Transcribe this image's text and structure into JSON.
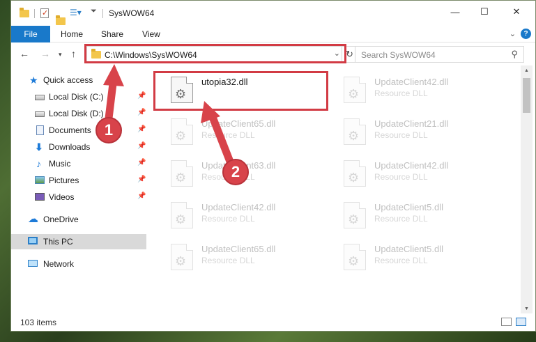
{
  "window": {
    "title": "SysWOW64"
  },
  "ribbon": {
    "tabs": [
      "File",
      "Home",
      "Share",
      "View"
    ],
    "expand_glyph": "⌄",
    "help_glyph": "?"
  },
  "address": {
    "path": "C:\\Windows\\SysWOW64",
    "search_placeholder": "Search SysWOW64"
  },
  "sidebar": {
    "items": [
      {
        "label": "Quick access",
        "icon": "star-icon",
        "pinned": false
      },
      {
        "label": "Local Disk (C:)",
        "icon": "drive-icon",
        "pinned": true
      },
      {
        "label": "Local Disk (D:)",
        "icon": "drive-icon",
        "pinned": true
      },
      {
        "label": "Documents",
        "icon": "document-icon",
        "pinned": true
      },
      {
        "label": "Downloads",
        "icon": "download-icon",
        "pinned": true
      },
      {
        "label": "Music",
        "icon": "music-icon",
        "pinned": true
      },
      {
        "label": "Pictures",
        "icon": "pictures-icon",
        "pinned": true
      },
      {
        "label": "Videos",
        "icon": "videos-icon",
        "pinned": true
      },
      {
        "label": "OneDrive",
        "icon": "cloud-icon",
        "pinned": false
      },
      {
        "label": "This PC",
        "icon": "computer-icon",
        "pinned": false,
        "selected": true
      },
      {
        "label": "Network",
        "icon": "network-icon",
        "pinned": false
      }
    ]
  },
  "files": [
    {
      "name": "utopia32.dll",
      "type": "",
      "faded": false
    },
    {
      "name": "UpdateClient42.dll",
      "type": "Resource DLL",
      "faded": true
    },
    {
      "name": "UpdateClient65.dll",
      "type": "Resource DLL",
      "faded": true
    },
    {
      "name": "UpdateClient21.dll",
      "type": "Resource DLL",
      "faded": true
    },
    {
      "name": "UpdateClient63.dll",
      "type": "Resource DLL",
      "faded": true
    },
    {
      "name": "UpdateClient42.dll",
      "type": "Resource DLL",
      "faded": true
    },
    {
      "name": "UpdateClient42.dll",
      "type": "Resource DLL",
      "faded": true
    },
    {
      "name": "UpdateClient5.dll",
      "type": "Resource DLL",
      "faded": true
    },
    {
      "name": "UpdateClient65.dll",
      "type": "Resource DLL",
      "faded": true
    },
    {
      "name": "UpdateClient5.dll",
      "type": "Resource DLL",
      "faded": true
    }
  ],
  "status": {
    "item_count": "103 items"
  },
  "annotations": {
    "badge_1": "1",
    "badge_2": "2",
    "highlight_color": "#d23b44"
  },
  "colors": {
    "accent": "#1979ca",
    "annotation_red": "#d8434a"
  }
}
